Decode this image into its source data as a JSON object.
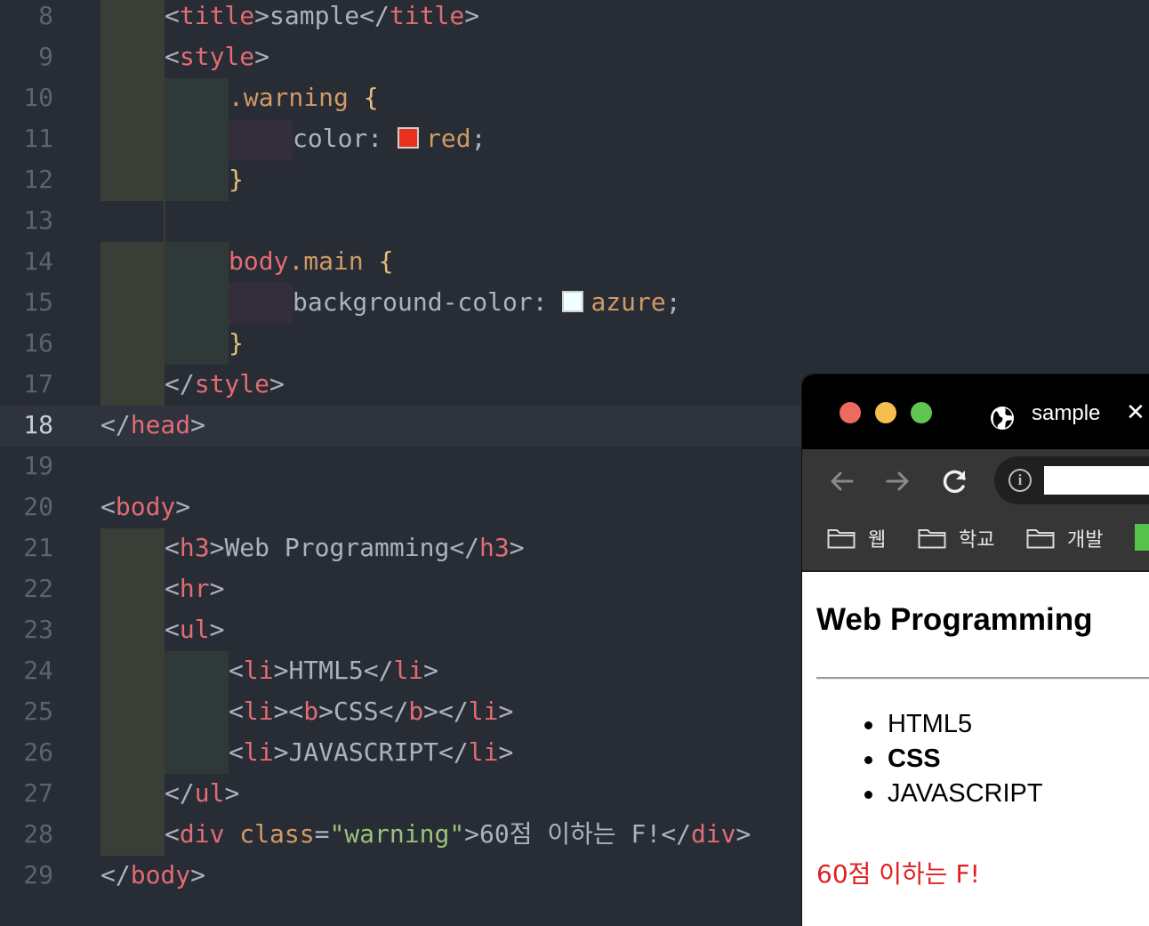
{
  "editor": {
    "active_line": "18",
    "lines": [
      {
        "num": "8"
      },
      {
        "num": "9"
      },
      {
        "num": "10"
      },
      {
        "num": "11"
      },
      {
        "num": "12"
      },
      {
        "num": "13"
      },
      {
        "num": "14"
      },
      {
        "num": "15"
      },
      {
        "num": "16"
      },
      {
        "num": "17"
      },
      {
        "num": "18"
      },
      {
        "num": "19"
      },
      {
        "num": "20"
      },
      {
        "num": "21"
      },
      {
        "num": "22"
      },
      {
        "num": "23"
      },
      {
        "num": "24"
      },
      {
        "num": "25"
      },
      {
        "num": "26"
      },
      {
        "num": "27"
      },
      {
        "num": "28"
      },
      {
        "num": "29"
      }
    ],
    "code": {
      "l8_open": "<",
      "l8_tag": "title",
      "l8_close": ">",
      "l8_text": "sample",
      "l8_open2": "</",
      "l8_tag2": "title",
      "l8_close2": ">",
      "l9_open": "<",
      "l9_tag": "style",
      "l9_close": ">",
      "l10_sel": ".warning",
      "l10_brace": " {",
      "l11_prop": "color: ",
      "l11_val": "red",
      "l11_semi": ";",
      "l12_brace": "}",
      "l14_tag": "body",
      "l14_cls": ".main",
      "l14_brace": " {",
      "l15_prop": "background-color: ",
      "l15_val": "azure",
      "l15_semi": ";",
      "l16_brace": "}",
      "l17_open": "</",
      "l17_tag": "style",
      "l17_close": ">",
      "l18_open": "</",
      "l18_tag": "head",
      "l18_close": ">",
      "l20_open": "<",
      "l20_tag": "body",
      "l20_close": ">",
      "l21_open": "<",
      "l21_tag": "h3",
      "l21_close": ">",
      "l21_text": "Web Programming",
      "l21_open2": "</",
      "l21_tag2": "h3",
      "l21_close2": ">",
      "l22_open": "<",
      "l22_tag": "hr",
      "l22_close": ">",
      "l23_open": "<",
      "l23_tag": "ul",
      "l23_close": ">",
      "l24_open": "<",
      "l24_tag": "li",
      "l24_close": ">",
      "l24_text": "HTML5",
      "l24_open2": "</",
      "l24_tag2": "li",
      "l24_close2": ">",
      "l25_open": "<",
      "l25_tag": "li",
      "l25_mid1": "><",
      "l25_tag_b": "b",
      "l25_close": ">",
      "l25_text": "CSS",
      "l25_open2": "</",
      "l25_tag_b2": "b",
      "l25_mid2": "></",
      "l25_tag2": "li",
      "l25_close2": ">",
      "l26_open": "<",
      "l26_tag": "li",
      "l26_close": ">",
      "l26_text": "JAVASCRIPT",
      "l26_open2": "</",
      "l26_tag2": "li",
      "l26_close2": ">",
      "l27_open": "</",
      "l27_tag": "ul",
      "l27_close": ">",
      "l28_open": "<",
      "l28_tag": "div",
      "l28_attr": " class",
      "l28_eq": "=",
      "l28_str": "\"warning\"",
      "l28_close": ">",
      "l28_text": "60점 이하는 F!",
      "l28_open2": "</",
      "l28_tag2": "div",
      "l28_close2": ">",
      "l29_open": "</",
      "l29_tag": "body",
      "l29_close": ">"
    },
    "colors": {
      "red_swatch": "#e8301e",
      "azure_swatch": "#f0ffff"
    }
  },
  "browser": {
    "tab_title": "sample",
    "tab_close": "✕",
    "address_info": "i",
    "bookmarks": [
      {
        "label": "웹"
      },
      {
        "label": "학교"
      },
      {
        "label": "개발"
      }
    ],
    "page": {
      "h3": "Web Programming",
      "list": [
        {
          "text": "HTML5"
        },
        {
          "text": "CSS"
        },
        {
          "text": "JAVASCRIPT"
        }
      ],
      "warning": "60점 이하는 F!",
      "warning_color": "#e02020"
    }
  }
}
